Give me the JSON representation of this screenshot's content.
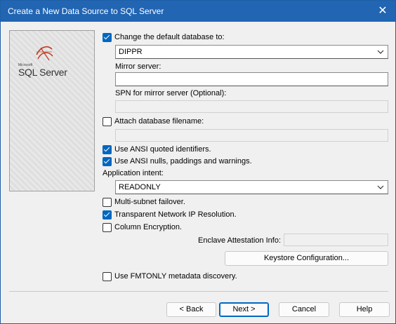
{
  "window": {
    "title": "Create a New Data Source to SQL Server"
  },
  "logo": {
    "small_text": "Microsoft",
    "big_text": "SQL Server"
  },
  "options": {
    "change_db": {
      "label": "Change the default database to:",
      "checked": true
    },
    "database": {
      "value": "DIPPR"
    },
    "mirror_server": {
      "label": "Mirror server:",
      "value": ""
    },
    "spn": {
      "label": "SPN for mirror server (Optional):",
      "value": ""
    },
    "attach_db": {
      "label": "Attach database filename:",
      "checked": false
    },
    "ansi_quoted": {
      "label": "Use ANSI quoted identifiers.",
      "checked": true
    },
    "ansi_nulls": {
      "label": "Use ANSI nulls, paddings and warnings.",
      "checked": true
    },
    "app_intent": {
      "label": "Application intent:",
      "value": "READONLY"
    },
    "multi_subnet": {
      "label": "Multi-subnet failover.",
      "checked": false
    },
    "tnir": {
      "label": "Transparent Network IP Resolution.",
      "checked": true
    },
    "column_enc": {
      "label": "Column Encryption.",
      "checked": false
    },
    "enclave": {
      "label": "Enclave Attestation Info:",
      "value": ""
    },
    "keystore_btn": "Keystore Configuration...",
    "fmtonly": {
      "label": "Use FMTONLY metadata discovery.",
      "checked": false
    }
  },
  "buttons": {
    "back": "< Back",
    "next": "Next >",
    "cancel": "Cancel",
    "help": "Help"
  },
  "colors": {
    "titlebar": "#2165b3",
    "accent": "#0067c0"
  }
}
